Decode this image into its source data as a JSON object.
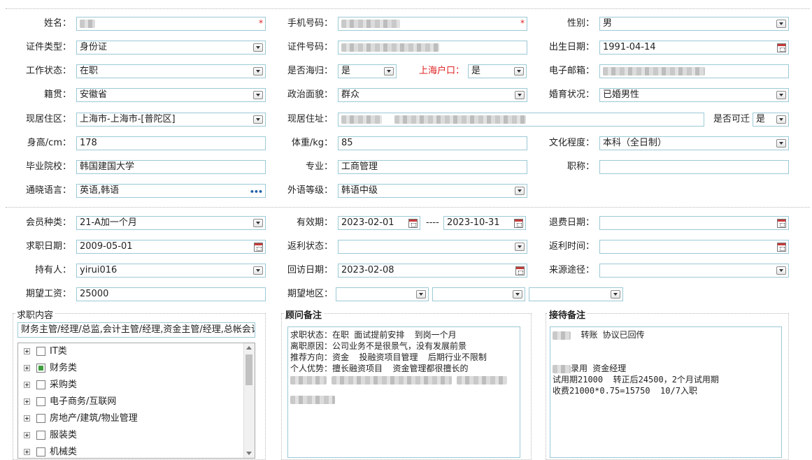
{
  "basic": {
    "name": {
      "label": "姓名：",
      "value": ""
    },
    "phone": {
      "label": "手机号码：",
      "value": ""
    },
    "gender": {
      "label": "性别：",
      "value": "男"
    },
    "id_type": {
      "label": "证件类型：",
      "value": "身份证"
    },
    "id_number": {
      "label": "证件号码：",
      "value": ""
    },
    "birth": {
      "label": "出生日期：",
      "value": "1991-04-14"
    },
    "work_status": {
      "label": "工作状态：",
      "value": "在职"
    },
    "returnee": {
      "label": "是否海归：",
      "value": "是"
    },
    "sh_hukou": {
      "label": "上海户口：",
      "value": "是"
    },
    "email": {
      "label": "电子邮箱：",
      "value": ""
    },
    "native": {
      "label": "籍贯：",
      "value": "安徽省"
    },
    "political": {
      "label": "政治面貌：",
      "value": "群众"
    },
    "marital": {
      "label": "婚育状况：",
      "value": "已婚男性"
    },
    "residence_area": {
      "label": "现居住区：",
      "value": "上海市-上海市-[普陀区]"
    },
    "address": {
      "label": "现居住址：",
      "value": ""
    },
    "relocate": {
      "label": "是否可迁",
      "value": "是"
    },
    "height": {
      "label": "身高/cm：",
      "value": "178"
    },
    "weight": {
      "label": "体重/kg：",
      "value": "85"
    },
    "education": {
      "label": "文化程度：",
      "value": "本科（全日制）"
    },
    "school": {
      "label": "毕业院校：",
      "value": "韩国建国大学"
    },
    "major": {
      "label": "专业：",
      "value": "工商管理"
    },
    "title": {
      "label": "职称：",
      "value": ""
    },
    "languages": {
      "label": "通晓语言：",
      "value": "英语,韩语"
    },
    "lang_level": {
      "label": "外语等级：",
      "value": "韩语中级"
    }
  },
  "member": {
    "member_type": {
      "label": "会员种类：",
      "value": "21-A加一个月"
    },
    "validity": {
      "label": "有效期：",
      "start": "2023-02-01",
      "sep": "----",
      "end": "2023-10-31"
    },
    "refund_date": {
      "label": "退费日期：",
      "value": ""
    },
    "job_date": {
      "label": "求职日期：",
      "value": "2009-05-01"
    },
    "rebate_status": {
      "label": "返利状态：",
      "value": ""
    },
    "rebate_time": {
      "label": "返利时间：",
      "value": ""
    },
    "holder": {
      "label": "持有人：",
      "value": "yirui016"
    },
    "visit_date": {
      "label": "回访日期：",
      "value": "2023-02-08"
    },
    "source": {
      "label": "来源途径：",
      "value": ""
    },
    "salary": {
      "label": "期望工资：",
      "value": "25000"
    },
    "region": {
      "label": "期望地区：",
      "values": [
        "",
        "",
        ""
      ]
    }
  },
  "job_panel": {
    "title": "求职内容",
    "summary": "财务主管/经理/总监,会计主管/经理,资金主管/经理,总帐会计",
    "tree": [
      {
        "label": "IT类",
        "checked": false
      },
      {
        "label": "财务类",
        "checked": true
      },
      {
        "label": "采购类",
        "checked": false
      },
      {
        "label": "电子商务/互联网",
        "checked": false
      },
      {
        "label": "房地产/建筑/物业管理",
        "checked": false
      },
      {
        "label": "服装类",
        "checked": false
      },
      {
        "label": "机械类",
        "checked": false
      }
    ]
  },
  "advisor_panel": {
    "title": "顾问备注",
    "lines": [
      "求职状态：在职 面试提前安排  到岗一个月",
      "离职原因：公司业务不是很景气，没有发展前景",
      "推荐方向：资金  投融资项目管理  后期行业不限制",
      "个人优势：擅长融资项目  资金管理都很擅长的"
    ]
  },
  "reception_panel": {
    "title": "接待备注",
    "line1": "转账 协议已回传",
    "line2": "录用 资金经理",
    "line3": "试用期21000  转正后24500，2个月试用期",
    "line4": "收费21000*0.75=15750  10/7入职"
  }
}
